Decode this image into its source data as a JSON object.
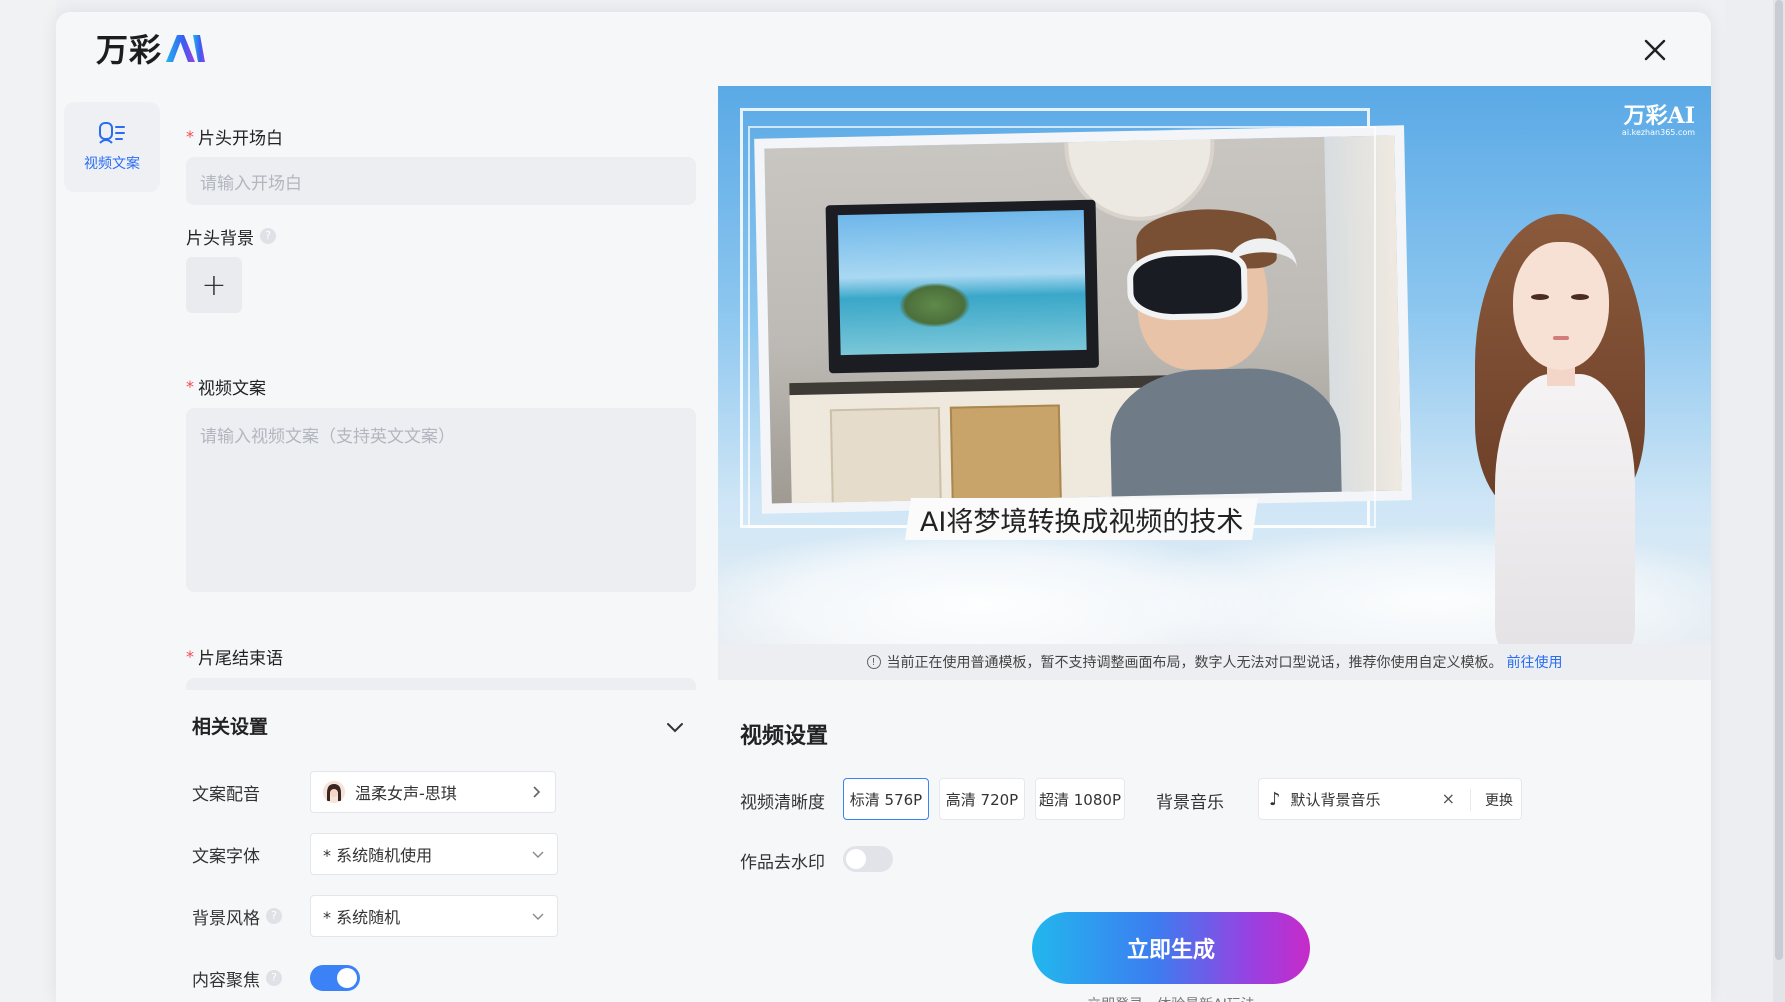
{
  "brand": {
    "logo_text": "万彩",
    "logo_ai": "AI",
    "preview_logo_main": "万彩AI",
    "preview_logo_sub": "ai.kezhan365.com"
  },
  "colors": {
    "accent": "#2a6df4",
    "toggle_on": "#3b82f6",
    "required": "#f04d4d",
    "gradient_start": "#22b7ee",
    "gradient_end": "#c62bc9"
  },
  "side_nav": {
    "items": [
      {
        "label": "视频文案",
        "icon": "script-icon",
        "active": true
      }
    ]
  },
  "form": {
    "opening": {
      "label": "片头开场白",
      "required": true,
      "placeholder": "请输入开场白"
    },
    "opening_bg": {
      "label": "片头背景",
      "upload_symbol": "+"
    },
    "script": {
      "label": "视频文案",
      "required": true,
      "placeholder": "请输入视频文案（支持英文文案）"
    },
    "ending": {
      "label": "片尾结束语",
      "required": true
    }
  },
  "related_settings": {
    "title": "相关设置",
    "voice": {
      "label": "文案配音",
      "value": "温柔女声-思琪"
    },
    "font": {
      "label": "文案字体",
      "value": "* 系统随机使用"
    },
    "bg_style": {
      "label": "背景风格",
      "value": "* 系统随机"
    },
    "focus": {
      "label": "内容聚焦",
      "enabled": true
    }
  },
  "preview": {
    "caption": "AI将梦境转换成视频的技术"
  },
  "notice": {
    "text": "当前正在使用普通模板，暂不支持调整画面布局，数字人无法对口型说话，推荐你使用自定义模板。",
    "link": "前往使用"
  },
  "video_settings": {
    "title": "视频设置",
    "resolution_label": "视频清晰度",
    "resolutions": [
      "标清 576P",
      "高清 720P",
      "超清 1080P"
    ],
    "selected_resolution": "标清 576P",
    "music_label": "背景音乐",
    "music_value": "默认背景音乐",
    "music_clear": "×",
    "music_swap": "更换",
    "watermark_label": "作品去水印",
    "watermark_enabled": false,
    "generate_label": "立即生成",
    "generate_sub": "立即登录，体验最新AI玩法"
  },
  "close_label": "×"
}
